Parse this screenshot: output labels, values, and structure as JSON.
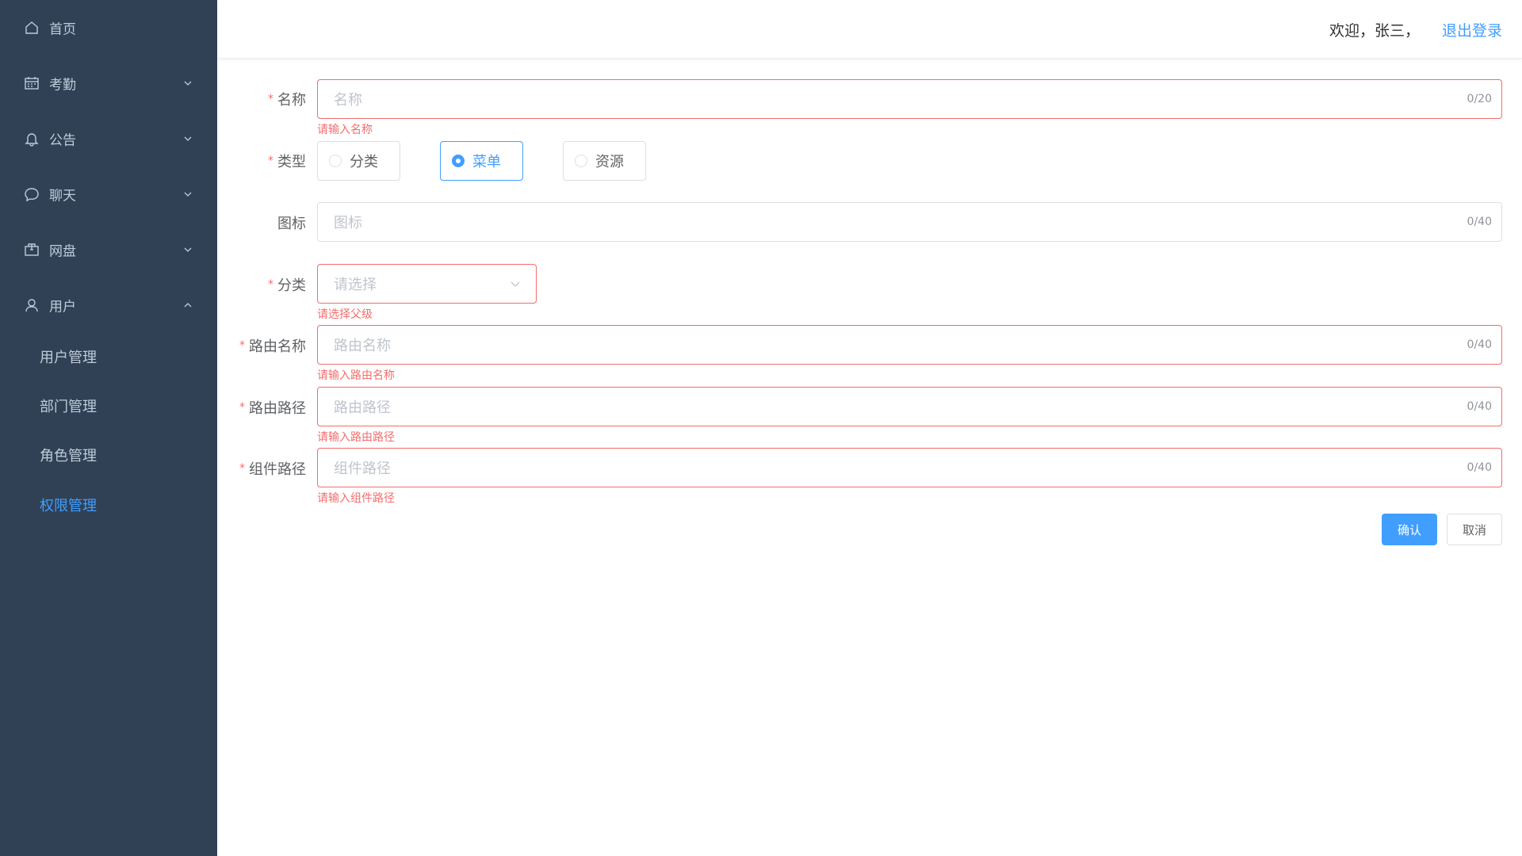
{
  "sidebar": {
    "items": [
      {
        "label": "首页",
        "icon": "home-icon"
      },
      {
        "label": "考勤",
        "icon": "calendar-icon"
      },
      {
        "label": "公告",
        "icon": "bell-icon"
      },
      {
        "label": "聊天",
        "icon": "chat-icon"
      },
      {
        "label": "网盘",
        "icon": "box-icon"
      },
      {
        "label": "用户",
        "icon": "user-icon"
      }
    ],
    "sub_items": [
      {
        "label": "用户管理"
      },
      {
        "label": "部门管理"
      },
      {
        "label": "角色管理"
      },
      {
        "label": "权限管理"
      }
    ],
    "menu_text_color": "#bfcbd9",
    "active_color": "#409eff",
    "background": "#304156"
  },
  "header": {
    "welcome": "欢迎，张三，",
    "logout": "退出登录"
  },
  "form": {
    "name": {
      "label": "名称",
      "placeholder": "名称",
      "count": "0/20",
      "error": "请输入名称"
    },
    "type": {
      "label": "类型",
      "options": [
        "分类",
        "菜单",
        "资源"
      ],
      "selected": "菜单"
    },
    "icon": {
      "label": "图标",
      "placeholder": "图标",
      "count": "0/40"
    },
    "category": {
      "label": "分类",
      "placeholder": "请选择",
      "error": "请选择父级"
    },
    "route_name": {
      "label": "路由名称",
      "placeholder": "路由名称",
      "count": "0/40",
      "error": "请输入路由名称"
    },
    "route_path": {
      "label": "路由路径",
      "placeholder": "路由路径",
      "count": "0/40",
      "error": "请输入路由路径"
    },
    "component_path": {
      "label": "组件路径",
      "placeholder": "组件路径",
      "count": "0/40",
      "error": "请输入组件路径"
    },
    "confirm": "确认",
    "cancel": "取消"
  }
}
